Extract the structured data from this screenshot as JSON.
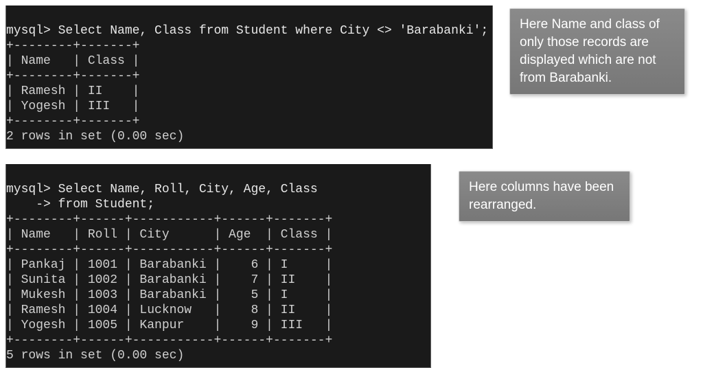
{
  "block1": {
    "promptLine": "mysql> Select Name, Class from Student where City <> 'Barabanki';",
    "divTop": "+--------+-------+",
    "header": "| Name   | Class |",
    "divMid": "+--------+-------+",
    "row1": "| Ramesh | II    |",
    "row2": "| Yogesh | III   |",
    "divBot": "+--------+-------+",
    "footer": "2 rows in set (0.00 sec)",
    "callout": "Here Name and class of only those records are displayed which are not from Barabanki."
  },
  "block2": {
    "promptLine1": "mysql> Select Name, Roll, City, Age, Class",
    "promptLine2": "    -> from Student;",
    "divTop": "+--------+------+-----------+------+-------+",
    "header": "| Name   | Roll | City      | Age  | Class |",
    "divMid": "+--------+------+-----------+------+-------+",
    "row1": "| Pankaj | 1001 | Barabanki |    6 | I     |",
    "row2": "| Sunita | 1002 | Barabanki |    7 | II    |",
    "row3": "| Mukesh | 1003 | Barabanki |    5 | I     |",
    "row4": "| Ramesh | 1004 | Lucknow   |    8 | II    |",
    "row5": "| Yogesh | 1005 | Kanpur    |    9 | III   |",
    "divBot": "+--------+------+-----------+------+-------+",
    "footer": "5 rows in set (0.00 sec)",
    "callout": "Here columns have been rearranged."
  }
}
